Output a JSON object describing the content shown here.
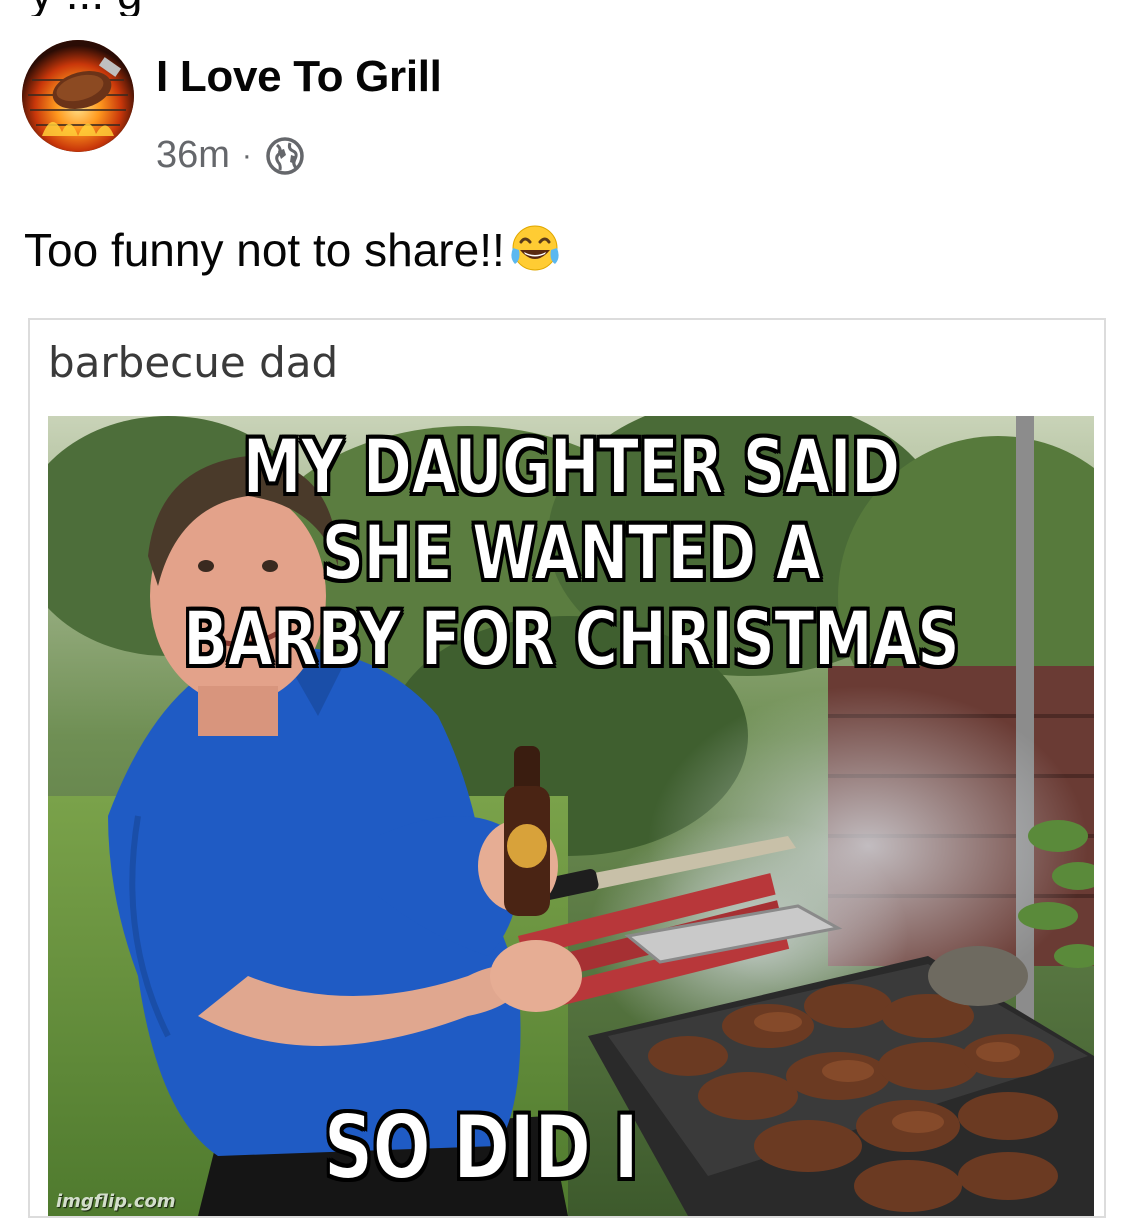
{
  "post": {
    "page_name": "I Love To Grill",
    "timestamp": "36m",
    "separator": "·",
    "audience_icon": "globe-icon",
    "text": "Too funny not to share!!",
    "emoji": "face-with-tears-of-joy"
  },
  "meme": {
    "caption": "barbecue dad",
    "top_lines": [
      "MY DAUGHTER SAID",
      "SHE WANTED A",
      "BARBY FOR CHRISTMAS"
    ],
    "bottom_text": "SO DID I",
    "watermark": "imgflip.com"
  },
  "colors": {
    "text_primary": "#050505",
    "text_secondary": "#65676b",
    "shirt": "#1f5bc4",
    "grass": "#5f8f3a"
  }
}
